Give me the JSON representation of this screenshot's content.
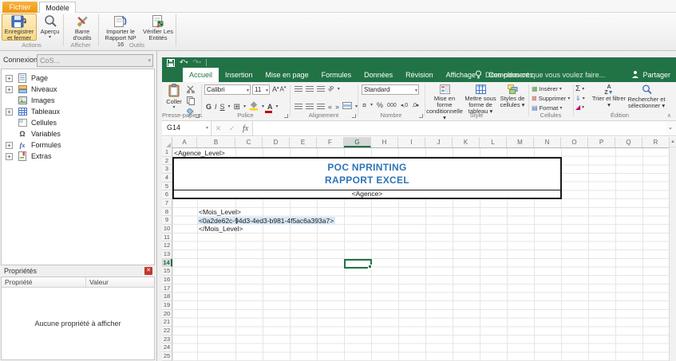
{
  "np": {
    "tabs": {
      "fichier": "Fichier",
      "modele": "Modèle"
    },
    "ribbon": {
      "save_close": "Enregistrer et fermer",
      "apercu": "Aperçu",
      "barre": "Barre d'outils",
      "importer": "Importer le Rapport NP 16",
      "verifier": "Vérifier Les Entités",
      "groups": {
        "actions": "Actions",
        "afficher": "Afficher",
        "outils": "Outils"
      }
    },
    "connexion": {
      "label": "Connexion",
      "value": "CoS..."
    },
    "tree": [
      {
        "label": "Page",
        "icon": "page",
        "expandable": true
      },
      {
        "label": "Niveaux",
        "icon": "levels",
        "expandable": true
      },
      {
        "label": "Images",
        "icon": "images",
        "expandable": false
      },
      {
        "label": "Tableaux",
        "icon": "tables",
        "expandable": true
      },
      {
        "label": "Cellules",
        "icon": "cells",
        "expandable": false
      },
      {
        "label": "Variables",
        "icon": "variables",
        "expandable": false
      },
      {
        "label": "Formules",
        "icon": "formulas",
        "expandable": true
      },
      {
        "label": "Extras",
        "icon": "extras",
        "expandable": true
      }
    ],
    "properties": {
      "title": "Propriétés",
      "col_property": "Propriété",
      "col_value": "Valeur",
      "empty": "Aucune propriété à afficher"
    }
  },
  "excel": {
    "tabs": [
      "Accueil",
      "Insertion",
      "Mise en page",
      "Formules",
      "Données",
      "Révision",
      "Affichage",
      "Compléments"
    ],
    "active_tab": "Accueil",
    "tell_me": "Dites-nous ce que vous voulez faire...",
    "share": "Partager",
    "ribbon": {
      "paste": "Coller",
      "font_name": "Calibri",
      "font_size": "11",
      "bold": "G",
      "italic": "I",
      "underline": "S",
      "number_format": "Standard",
      "cond_format": "Mise en forme conditionnelle ▾",
      "format_table": "Mettre sous forme de tableau ▾",
      "cell_styles": "Styles de cellules ▾",
      "insert": "Insérer",
      "delete": "Supprimer",
      "format": "Format",
      "sort_filter": "Trier et filtrer ▾",
      "find_select": "Rechercher et sélectionner ▾",
      "groups": {
        "clipboard": "Presse-papiers",
        "font": "Police",
        "alignment": "Alignement",
        "number": "Nombre",
        "style": "Style",
        "cells": "Cellules",
        "editing": "Édition"
      }
    },
    "formula": {
      "name_box": "G14",
      "fx": "fx"
    },
    "sheet": {
      "columns": [
        "A",
        "B",
        "C",
        "D",
        "E",
        "F",
        "G",
        "H",
        "I",
        "J",
        "K",
        "L",
        "M",
        "N",
        "O",
        "P",
        "Q",
        "R"
      ],
      "rows": [
        1,
        2,
        3,
        4,
        5,
        6,
        7,
        8,
        9,
        10,
        11,
        12,
        13,
        14,
        15,
        16,
        17,
        18,
        19,
        20,
        21,
        22,
        23,
        24,
        25
      ],
      "selected_column": "G",
      "selected_row": 14,
      "cells": {
        "a1": "<Agence_Level>",
        "title_line1": "POC NPRINTING",
        "title_line2": "RAPPORT EXCEL",
        "agence": "<Agence>",
        "mois_open": "<Mois_Level>",
        "guid": "<0a2de62c-94d3-4ed3-b981-4f5ac6a393a7>",
        "mois_close": "</Mois_Level>"
      }
    }
  },
  "colors": {
    "excel_green": "#217346",
    "title_blue": "#2e75b6",
    "tag_highlight": "#d9e8f6",
    "fichier_orange": "#f19a1a"
  }
}
